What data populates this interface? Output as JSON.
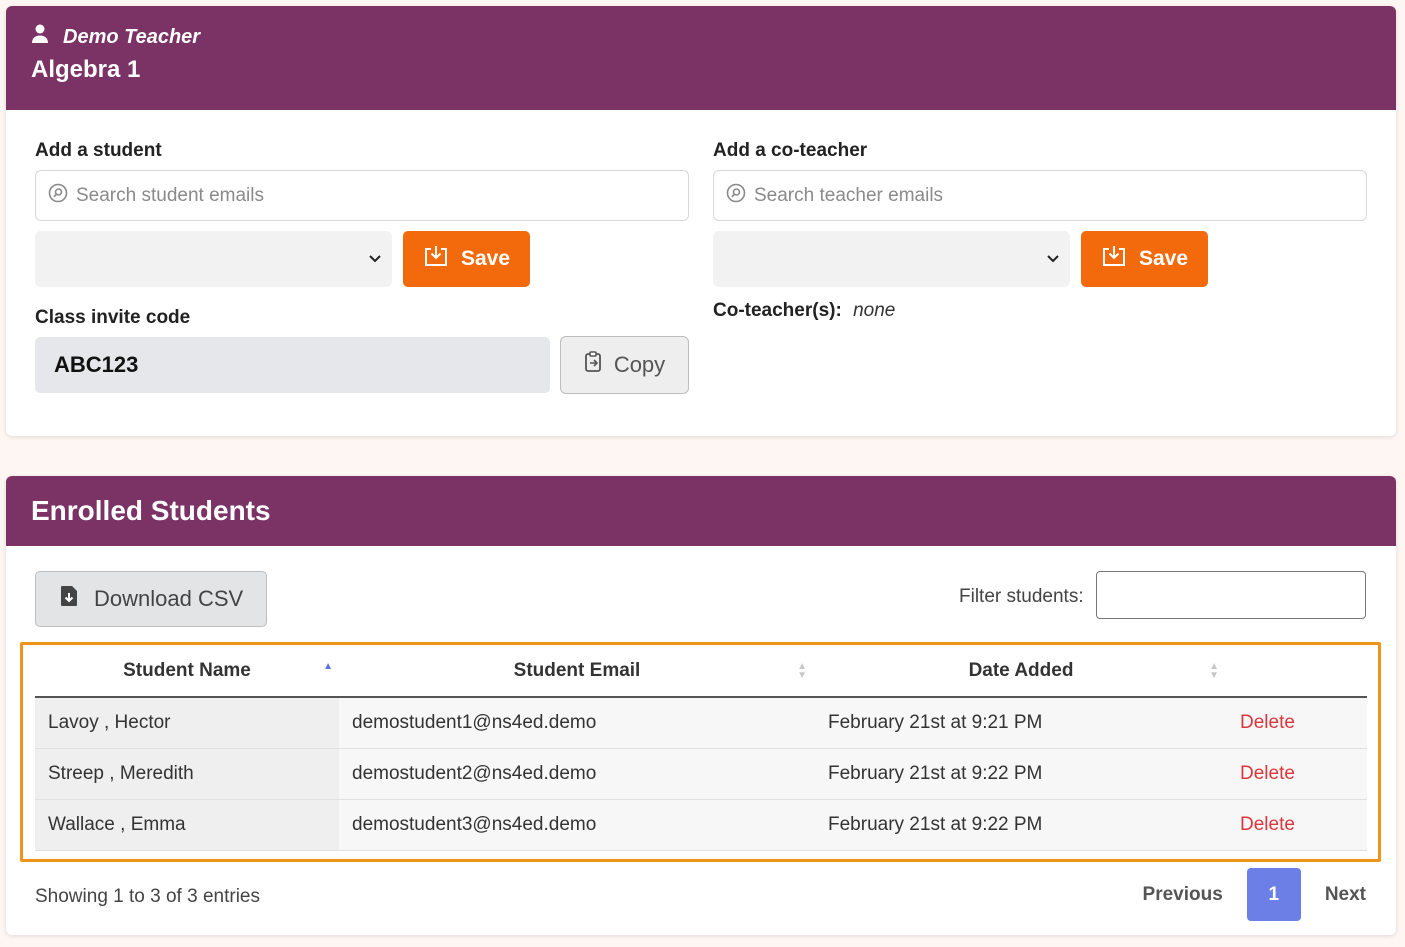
{
  "header": {
    "teacher_name": "Demo Teacher",
    "class_name": "Algebra 1"
  },
  "add_student": {
    "label": "Add a student",
    "search_placeholder": "Search student emails",
    "save_label": "Save"
  },
  "add_coteacher": {
    "label": "Add a co-teacher",
    "search_placeholder": "Search teacher emails",
    "save_label": "Save",
    "coteachers_label": "Co-teacher(s):",
    "coteachers_value": "none"
  },
  "invite": {
    "label": "Class invite code",
    "code": "ABC123",
    "copy_label": "Copy"
  },
  "enrolled": {
    "title": "Enrolled Students",
    "download_label": "Download CSV",
    "filter_label": "Filter students:",
    "columns": [
      "Student Name",
      "Student Email",
      "Date Added"
    ],
    "rows": [
      {
        "name": "Lavoy , Hector",
        "email": "demostudent1@ns4ed.demo",
        "date": "February 21st at 9:21 PM",
        "action": "Delete"
      },
      {
        "name": "Streep , Meredith",
        "email": "demostudent2@ns4ed.demo",
        "date": "February 21st at 9:22 PM",
        "action": "Delete"
      },
      {
        "name": "Wallace , Emma",
        "email": "demostudent3@ns4ed.demo",
        "date": "February 21st at 9:22 PM",
        "action": "Delete"
      }
    ],
    "showing": "Showing 1 to 3 of 3 entries",
    "pager": {
      "previous": "Previous",
      "current": "1",
      "next": "Next"
    }
  },
  "colors": {
    "header_bg": "#7b3366",
    "save_button": "#f26a0c",
    "delete_text": "#d9363e",
    "page_active": "#6b7fe6",
    "highlight_border": "#f0941c"
  }
}
